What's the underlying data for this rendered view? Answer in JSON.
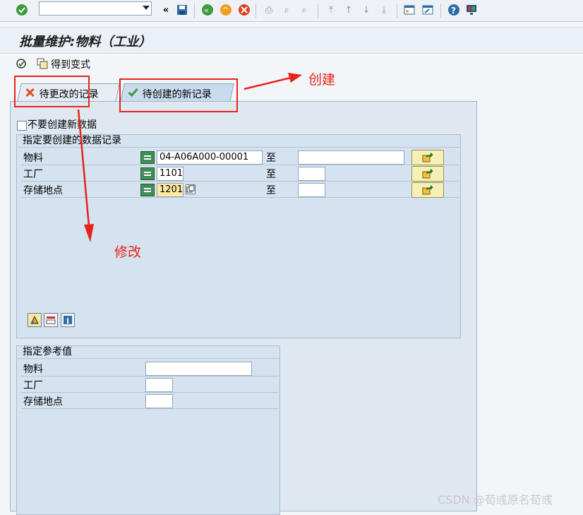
{
  "toolbar": {
    "enter_icon": "check-circle-icon",
    "command_field_value": "",
    "nav_back_glyph": "«",
    "icons": [
      "save-icon",
      "back-icon",
      "exit-icon",
      "cancel-icon",
      "print-icon",
      "find-icon",
      "find-next-icon",
      "first-page-icon",
      "prev-page-icon",
      "next-page-icon",
      "last-page-icon",
      "new-session-icon",
      "shortcut-icon",
      "help-icon",
      "customize-icon"
    ]
  },
  "title": "批量维护:物料（工业）",
  "app_toolbar": {
    "get_variant_label": "得到变式"
  },
  "tabs": [
    {
      "label": "待更改的记录",
      "icon": "red-x-icon"
    },
    {
      "label": "待创建的新记录",
      "icon": "green-check-icon",
      "active": true
    }
  ],
  "checkbox": {
    "label": "不要创建新数据",
    "checked": false
  },
  "group_specify": {
    "title": "指定要创建的数据记录",
    "to_label": "至",
    "rows": [
      {
        "label": "物料",
        "from": "04-A06A000-00001",
        "to": ""
      },
      {
        "label": "工厂",
        "from": "1101",
        "to": ""
      },
      {
        "label": "存储地点",
        "from": "1201",
        "to": ""
      }
    ]
  },
  "group_reference": {
    "title": "指定参考值",
    "rows": [
      {
        "label": "物料",
        "value": ""
      },
      {
        "label": "工厂",
        "value": ""
      },
      {
        "label": "存储地点",
        "value": ""
      }
    ]
  },
  "annotations": {
    "create": "创建",
    "modify": "修改",
    "color": "#e8231b"
  },
  "watermark": "CSDN @荀彧原名荀彧"
}
